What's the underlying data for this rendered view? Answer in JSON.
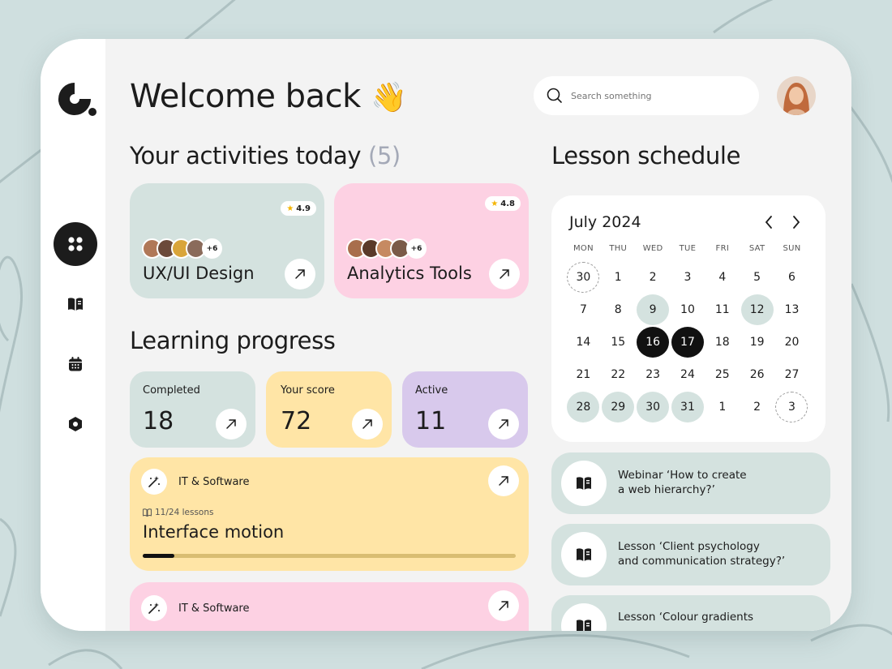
{
  "header": {
    "welcome": "Welcome back",
    "wave_emoji": "👋",
    "search_placeholder": "Search something"
  },
  "sidebar": {
    "items": [
      {
        "icon": "grid-icon",
        "active": true
      },
      {
        "icon": "book-icon",
        "active": false
      },
      {
        "icon": "calendar-icon",
        "active": false
      },
      {
        "icon": "settings-hexagon-icon",
        "active": false
      }
    ]
  },
  "activities": {
    "title": "Your activities today",
    "count": "(5)",
    "cards": [
      {
        "title": "UX/UI Design",
        "rating": "4.9",
        "more": "+6",
        "color": "#d4e2df"
      },
      {
        "title": "Analytics Tools",
        "rating": "4.8",
        "more": "+6",
        "color": "#fdd1e3"
      }
    ]
  },
  "progress": {
    "title": "Learning progress",
    "stats": [
      {
        "label": "Completed",
        "value": "18",
        "color": "#d4e2df"
      },
      {
        "label": "Your score",
        "value": "72",
        "color": "#ffe5a6"
      },
      {
        "label": "Active",
        "value": "11",
        "color": "#d8c9ec"
      }
    ],
    "courses": [
      {
        "category": "IT & Software",
        "lessons": "11/24 lessons",
        "title": "Interface motion",
        "progress": 0.085,
        "color": "#ffe5a6"
      },
      {
        "category": "IT & Software",
        "color": "#fdd1e3"
      }
    ]
  },
  "schedule": {
    "title": "Lesson schedule",
    "month": "July 2024",
    "weekdays": [
      "MON",
      "THU",
      "WED",
      "TUE",
      "FRI",
      "SAT",
      "SUN"
    ],
    "days": [
      {
        "d": "30",
        "s": "dash"
      },
      {
        "d": "1"
      },
      {
        "d": "2"
      },
      {
        "d": "3"
      },
      {
        "d": "4"
      },
      {
        "d": "5"
      },
      {
        "d": "6"
      },
      {
        "d": "7"
      },
      {
        "d": "8"
      },
      {
        "d": "9",
        "s": "hl"
      },
      {
        "d": "10"
      },
      {
        "d": "11"
      },
      {
        "d": "12",
        "s": "hl"
      },
      {
        "d": "13"
      },
      {
        "d": "14"
      },
      {
        "d": "15"
      },
      {
        "d": "16",
        "s": "sel"
      },
      {
        "d": "17",
        "s": "sel"
      },
      {
        "d": "18"
      },
      {
        "d": "19"
      },
      {
        "d": "20"
      },
      {
        "d": "21"
      },
      {
        "d": "22"
      },
      {
        "d": "23"
      },
      {
        "d": "24"
      },
      {
        "d": "25"
      },
      {
        "d": "26"
      },
      {
        "d": "27"
      },
      {
        "d": "28",
        "s": "hl"
      },
      {
        "d": "29",
        "s": "hl"
      },
      {
        "d": "30",
        "s": "hl"
      },
      {
        "d": "31",
        "s": "hl"
      },
      {
        "d": "1"
      },
      {
        "d": "2"
      },
      {
        "d": "3",
        "s": "dash"
      }
    ],
    "events": [
      {
        "line1": "Webinar ‘How to create",
        "line2": "a web hierarchy?’"
      },
      {
        "line1": "Lesson ‘Client psychology",
        "line2": "and communication strategy?’"
      },
      {
        "line1": "Lesson ‘Colour gradients",
        "line2": ""
      }
    ]
  },
  "colors": {
    "mint": "#d4e2df",
    "pink": "#fdd1e3",
    "yellow": "#ffe5a6",
    "lavender": "#d8c9ec",
    "dark": "#111111"
  }
}
